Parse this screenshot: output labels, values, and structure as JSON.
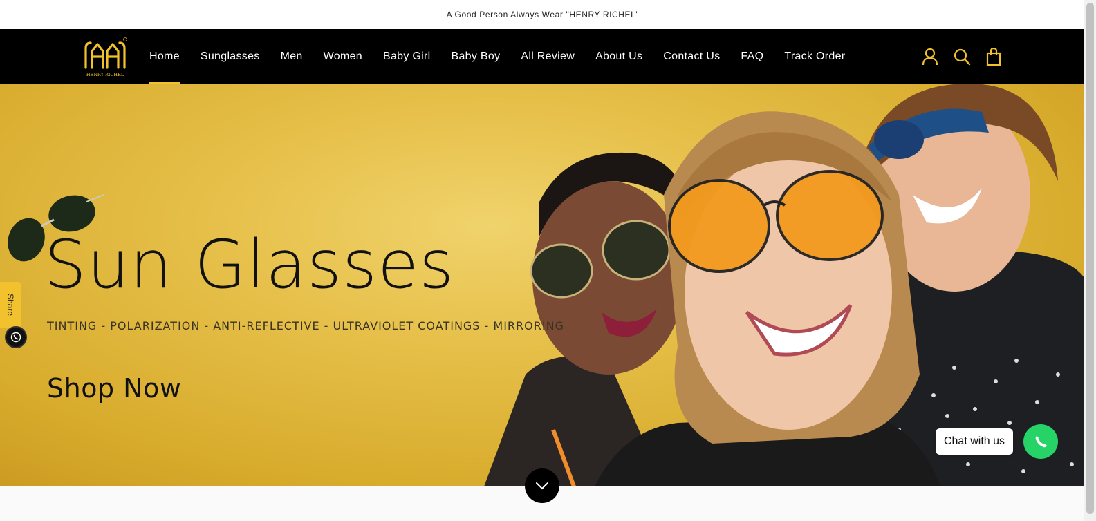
{
  "announcement": {
    "text": "A Good Person Always Wear \"HENRY RICHEL'"
  },
  "brand": {
    "name": "HENRY RICHEL",
    "accent_color": "#f2c12e"
  },
  "nav": {
    "items": [
      {
        "label": "Home",
        "active": true
      },
      {
        "label": "Sunglasses",
        "active": false
      },
      {
        "label": "Men",
        "active": false
      },
      {
        "label": "Women",
        "active": false
      },
      {
        "label": "Baby Girl",
        "active": false
      },
      {
        "label": "Baby Boy",
        "active": false
      },
      {
        "label": "All Review",
        "active": false
      },
      {
        "label": "About Us",
        "active": false
      },
      {
        "label": "Contact Us",
        "active": false
      },
      {
        "label": "FAQ",
        "active": false
      },
      {
        "label": "Track Order",
        "active": false
      }
    ]
  },
  "header_icons": [
    "account-icon",
    "search-icon",
    "cart-icon"
  ],
  "hero": {
    "title": "Sun Glasses",
    "subtitle": "TINTING - POLARIZATION - ANTI-REFLECTIVE - ULTRAVIOLET COATINGS - MIRRORING",
    "cta": "Shop Now"
  },
  "share": {
    "label": "Share",
    "icon": "whatsapp-icon"
  },
  "chat": {
    "label": "Chat with us",
    "icon": "whatsapp-icon",
    "color": "#25d366"
  },
  "scroll": {
    "icon": "chevron-down-icon"
  }
}
